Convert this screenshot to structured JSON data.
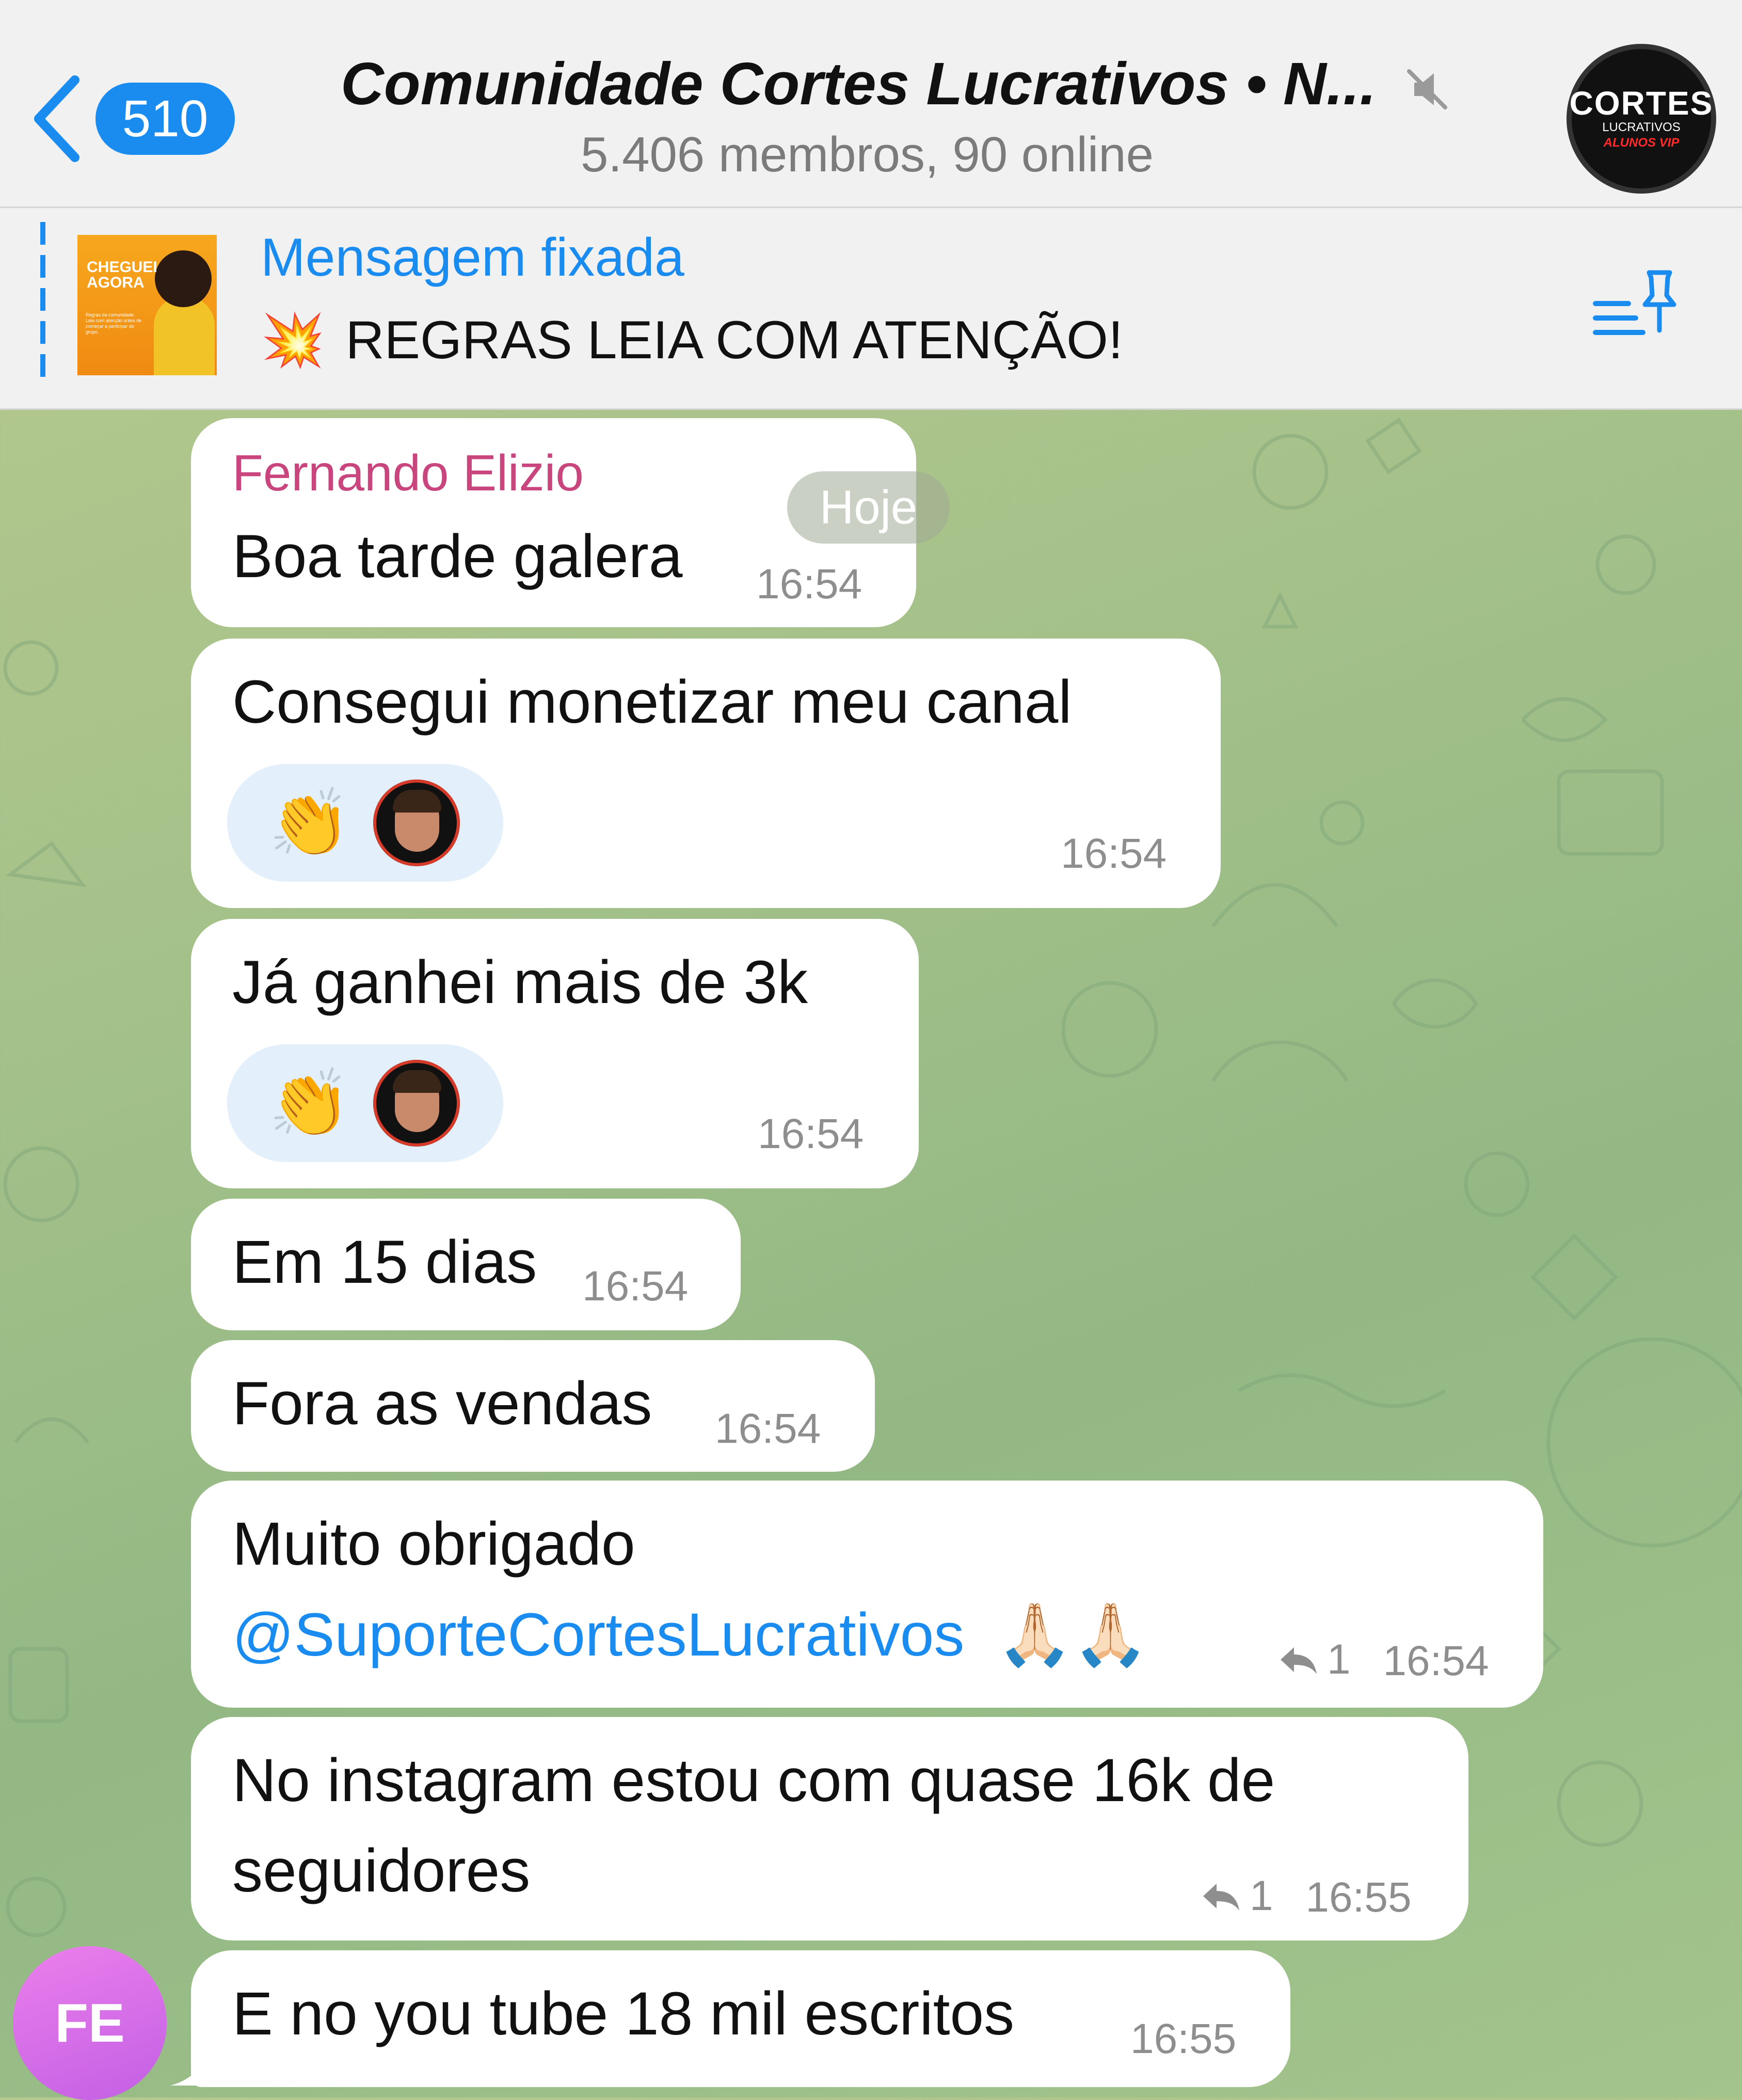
{
  "header": {
    "back_count": "510",
    "title": "Comunidade Cortes Lucrativos • N...",
    "subtitle": "5.406 membros, 90 online",
    "avatar": {
      "line1": "CORTES",
      "line2": "LUCRATIVOS",
      "line3": "ALUNOS VIP"
    }
  },
  "pinned": {
    "label": "Mensagem fixada",
    "emoji": "💥",
    "text": "REGRAS LEIA COM ATENÇÃO!",
    "thumb": {
      "heading": "CHEGUEI AGORA",
      "body": "Regras da comunidade. Leia com atenção antes de começar a participar do grupo."
    }
  },
  "date_chip": "Hoje",
  "sender_avatar": "FE",
  "messages": [
    {
      "sender": "Fernando Elizio",
      "text": "Boa tarde galera",
      "time": "16:54"
    },
    {
      "text": "Consegui monetizar meu canal",
      "time": "16:54",
      "reaction": "👏"
    },
    {
      "text": "Já ganhei mais de 3k",
      "time": "16:54",
      "reaction": "👏"
    },
    {
      "text": "Em 15 dias",
      "time": "16:54"
    },
    {
      "text": "Fora as vendas",
      "time": "16:54"
    },
    {
      "text_line1": "Muito obrigado",
      "mention": "@SuporteCortesLucrativos",
      "emoji": "🙏🏻🙏🏻",
      "replies": "1",
      "time": "16:54"
    },
    {
      "text_line1": "No instagram estou com quase 16k de",
      "text_line2": "seguidores",
      "replies": "1",
      "time": "16:55"
    },
    {
      "text": "E no you tube 18 mil escritos",
      "time": "16:55"
    }
  ],
  "colors": {
    "accent": "#1a8cf0",
    "sender_name": "#c8457e",
    "bubble": "#ffffff",
    "chat_bg": "#a6c28a"
  }
}
